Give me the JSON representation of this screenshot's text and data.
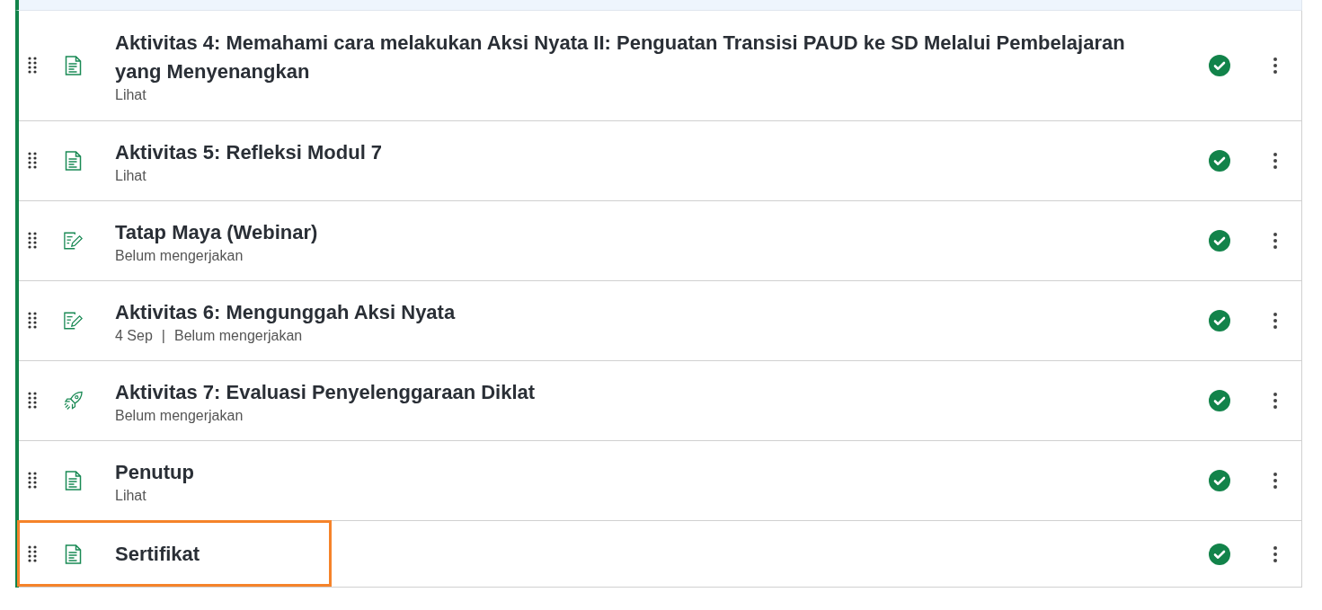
{
  "meta_separator": "|",
  "items": [
    {
      "title": "Aktivitas 4: Memahami cara melakukan Aksi Nyata II: Penguatan Transisi PAUD ke SD Melalui Pembelajaran yang Menyenangkan",
      "meta": [
        "Lihat"
      ],
      "kind": "page",
      "completed": true,
      "highlighted": false
    },
    {
      "title": "Aktivitas 5: Refleksi Modul 7",
      "meta": [
        "Lihat"
      ],
      "kind": "page",
      "completed": true,
      "highlighted": false
    },
    {
      "title": "Tatap Maya (Webinar)",
      "meta": [
        "Belum mengerjakan"
      ],
      "kind": "assignment",
      "completed": true,
      "highlighted": false
    },
    {
      "title": "Aktivitas 6: Mengunggah Aksi Nyata",
      "meta": [
        "4 Sep",
        "Belum mengerjakan"
      ],
      "kind": "assignment",
      "completed": true,
      "highlighted": false
    },
    {
      "title": "Aktivitas 7: Evaluasi Penyelenggaraan Diklat",
      "meta": [
        "Belum mengerjakan"
      ],
      "kind": "rocket",
      "completed": true,
      "highlighted": false
    },
    {
      "title": "Penutup",
      "meta": [
        "Lihat"
      ],
      "kind": "page",
      "completed": true,
      "highlighted": false
    },
    {
      "title": "Sertifikat",
      "kind": "page",
      "completed": true,
      "highlighted": true
    }
  ]
}
